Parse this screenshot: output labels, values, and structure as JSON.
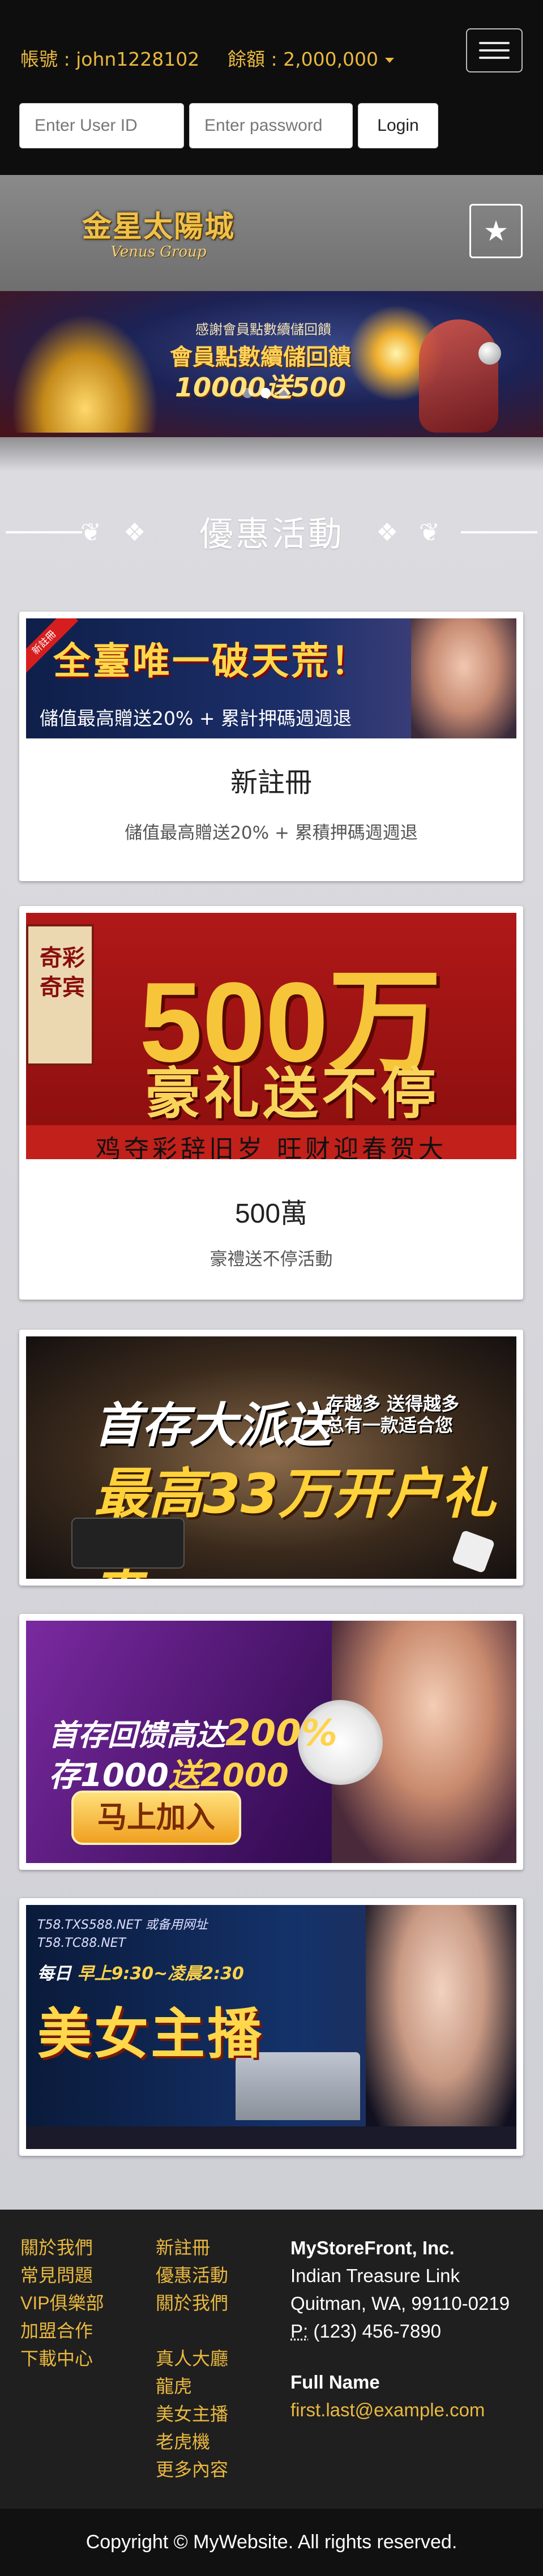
{
  "header": {
    "account_label": "帳號 : john1228102",
    "balance_label": "餘額 : 2,000,000",
    "user_placeholder": "Enter User ID",
    "password_placeholder": "Enter password",
    "login_label": "Login"
  },
  "brand": {
    "logo_cn": "金星太陽城",
    "logo_en": "Venus Group"
  },
  "hero": {
    "line1": "感謝會員點數續儲回饋",
    "line2": "會員點數續儲回饋",
    "line3": "10000送500",
    "slide_count": 3,
    "active_slide": 1
  },
  "section": {
    "title": "優惠活動"
  },
  "promos": [
    {
      "ribbon": "新註冊",
      "banner_head": "全臺唯一破天荒！",
      "banner_sub": "儲值最高贈送20% + 累計押碼週週退",
      "title": "新註冊",
      "desc": "儲值最高贈送20% + 累積押碼週週退"
    },
    {
      "banner_panel": "奇彩奇宾",
      "banner_big": "500万",
      "banner_slogan": "豪礼送不停",
      "banner_bottom": "鸡夺彩辞旧岁 旺财迎春贺大",
      "title": "500萬",
      "desc": "豪禮送不停活動"
    },
    {
      "banner_l1": "首存大派送",
      "banner_l1b": "存越多 送得越多\n总有一款适合您",
      "banner_l2": "最高33万开户礼金"
    },
    {
      "banner_l1_pre": "首存回馈高达",
      "banner_l1_num": "200%",
      "banner_l2_pre": "存1000",
      "banner_l2_num": "送2000",
      "banner_btn": "马上加入"
    },
    {
      "banner_t1": "T58.TXS588.NET 或备用网址\nT58.TC88.NET",
      "banner_t2_pre": "每日",
      "banner_t2_time": "早上9:30~凌晨2:30",
      "banner_head": "美女主播"
    }
  ],
  "footer": {
    "col1": [
      "關於我們",
      "常見問題",
      "VIP俱樂部",
      "加盟合作",
      "下載中心"
    ],
    "col2": [
      "新註冊",
      "優惠活動",
      "關於我們",
      "",
      "真人大廳",
      "龍虎",
      "美女主播",
      "老虎機",
      "更多內容"
    ],
    "company": "MyStoreFront, Inc.",
    "street": "Indian Treasure Link",
    "city": "Quitman, WA, 99110-0219",
    "phone_prefix": "P:",
    "phone": " (123) 456-7890",
    "name": "Full Name",
    "email": "first.last@example.com",
    "copyright": "Copyright © MyWebsite. All rights reserved."
  }
}
